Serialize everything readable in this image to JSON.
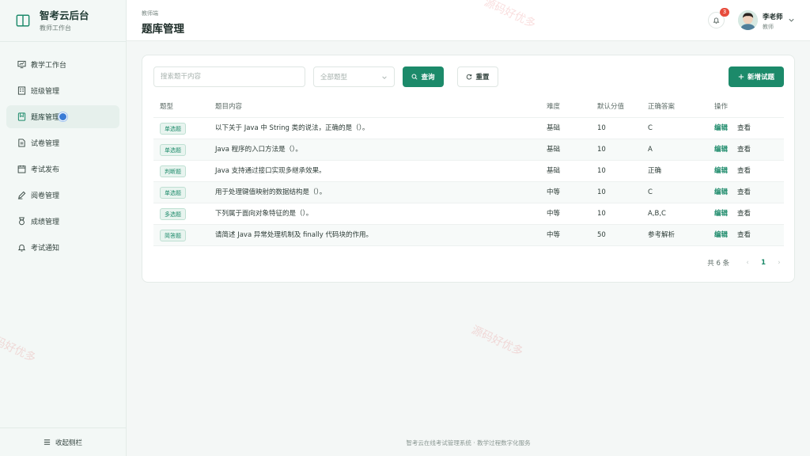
{
  "brand": {
    "title": "智考云后台",
    "subtitle": "教师工作台"
  },
  "sidebar": {
    "items": [
      {
        "label": "教学工作台",
        "icon": "chart-board-icon"
      },
      {
        "label": "班级管理",
        "icon": "building-icon"
      },
      {
        "label": "题库管理",
        "icon": "bookmark-icon",
        "active": true
      },
      {
        "label": "试卷管理",
        "icon": "document-icon"
      },
      {
        "label": "考试发布",
        "icon": "calendar-icon"
      },
      {
        "label": "阅卷管理",
        "icon": "pen-icon"
      },
      {
        "label": "成绩管理",
        "icon": "medal-icon"
      },
      {
        "label": "考试通知",
        "icon": "bell-icon"
      }
    ],
    "collapse_label": "收起侧栏"
  },
  "header": {
    "breadcrumb": "教师端",
    "title": "题库管理",
    "notification_count": "3",
    "user_name": "李老师",
    "user_role": "教师"
  },
  "toolbar": {
    "search_placeholder": "搜索题干内容",
    "type_select": "全部题型",
    "query_label": "查询",
    "reset_label": "重置",
    "new_label": "新增试题"
  },
  "table": {
    "headers": [
      "题型",
      "题目内容",
      "难度",
      "默认分值",
      "正确答案",
      "操作"
    ],
    "rows": [
      {
        "type": "单选题",
        "content": "以下关于 Java 中 String 类的说法，正确的是（）。",
        "difficulty": "基础",
        "score": "10",
        "answer": "C"
      },
      {
        "type": "单选题",
        "content": "Java 程序的入口方法是（）。",
        "difficulty": "基础",
        "score": "10",
        "answer": "A"
      },
      {
        "type": "判断题",
        "content": "Java 支持通过接口实现多继承效果。",
        "difficulty": "基础",
        "score": "10",
        "answer": "正确"
      },
      {
        "type": "单选题",
        "content": "用于处理键值映射的数据结构是（）。",
        "difficulty": "中等",
        "score": "10",
        "answer": "C"
      },
      {
        "type": "多选题",
        "content": "下列属于面向对象特征的是（）。",
        "difficulty": "中等",
        "score": "10",
        "answer": "A,B,C"
      },
      {
        "type": "简答题",
        "content": "请简述 Java 异常处理机制及 finally 代码块的作用。",
        "difficulty": "中等",
        "score": "50",
        "answer": "参考解析"
      }
    ],
    "edit_label": "编辑",
    "view_label": "查看"
  },
  "pagination": {
    "total": "共 6 条",
    "current_page": "1",
    "prev": "‹",
    "next": "›"
  },
  "footer": "智考云在线考试管理系统 · 教学过程数字化服务",
  "watermark": "源码好优多",
  "colors": {
    "accent": "#1c8a6a",
    "badge": "#e74c3c",
    "active_dot": "#3a7bd5"
  }
}
